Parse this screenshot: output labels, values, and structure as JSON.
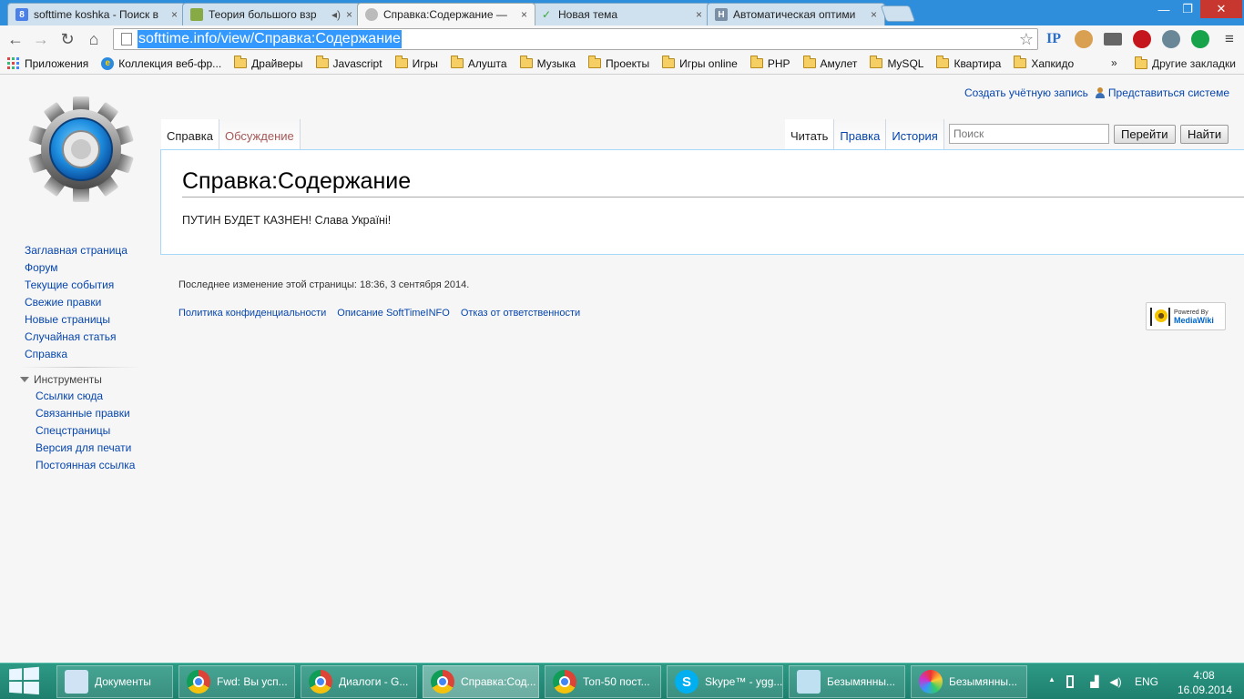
{
  "browser": {
    "tabs": [
      {
        "title": "softtime koshka - Поиск в",
        "fav": "8"
      },
      {
        "title": "Теория большого взр",
        "fav": ""
      },
      {
        "title": "Справка:Содержание —",
        "fav": ""
      },
      {
        "title": "Новая тема",
        "fav": ""
      },
      {
        "title": "Автоматическая оптими",
        "fav": "H"
      }
    ],
    "tab_close": "×",
    "window": {
      "minimize": "—",
      "maximize": "❐",
      "close": "✕"
    },
    "nav": {
      "back": "←",
      "forward": "→",
      "reload": "↻",
      "home": "⌂"
    },
    "url": "softtime.info/view/Справка:Содержание",
    "star": "☆",
    "extensions": [
      "IP",
      "cookie-icon",
      "mail-icon",
      "stop-icon",
      "drive-icon",
      "grammarly-icon"
    ],
    "menu": "≡"
  },
  "bookmarks": {
    "items": [
      "Приложения",
      "Коллекция веб-фр...",
      "Драйверы",
      "Javascript",
      "Игры",
      "Алушта",
      "Музыка",
      "Проекты",
      "Игры online",
      "PHP",
      "Амулет",
      "MySQL",
      "Квартира",
      "Хапкидо"
    ],
    "more": "»",
    "other": "Другие закладки"
  },
  "wiki": {
    "personal": {
      "create_account": "Создать учётную запись",
      "login": "Представиться системе"
    },
    "tabs_left": [
      "Справка",
      "Обсуждение"
    ],
    "tabs_right": [
      "Читать",
      "Правка",
      "История"
    ],
    "search_placeholder": "Поиск",
    "go_button": "Перейти",
    "find_button": "Найти",
    "heading": "Справка:Содержание",
    "body": "ПУТИН БУДЕТ КАЗНЕН! Слава Україні!",
    "navigation": [
      "Заглавная страница",
      "Форум",
      "Текущие события",
      "Свежие правки",
      "Новые страницы",
      "Случайная статья",
      "Справка"
    ],
    "tools_title": "Инструменты",
    "tools": [
      "Ссылки сюда",
      "Связанные правки",
      "Спецстраницы",
      "Версия для печати",
      "Постоянная ссылка"
    ],
    "last_modified": "Последнее изменение этой страницы: 18:36, 3 сентября 2014.",
    "footer_links": [
      "Политика конфиденциальности",
      "Описание SoftTimeINFO",
      "Отказ от ответственности"
    ],
    "powered_by": {
      "line1": "Powered By",
      "line2": "MediaWiki"
    }
  },
  "taskbar": {
    "buttons": [
      {
        "label": "Документы",
        "icon": "documents-icon"
      },
      {
        "label": "Fwd: Вы усп...",
        "icon": "chrome-icon"
      },
      {
        "label": "Диалоги - G...",
        "icon": "chrome-icon"
      },
      {
        "label": "Справка:Сод...",
        "icon": "chrome-icon"
      },
      {
        "label": "Топ-50 пост...",
        "icon": "chrome-icon"
      },
      {
        "label": "Skype™ - ygg...",
        "icon": "skype-icon"
      },
      {
        "label": "Безымянны...",
        "icon": "notepad-icon"
      },
      {
        "label": "Безымянны...",
        "icon": "paint-icon"
      }
    ],
    "tray": {
      "show_hidden": "▲",
      "lang": "ENG",
      "time": "4:08",
      "date": "16.09.2014"
    }
  }
}
